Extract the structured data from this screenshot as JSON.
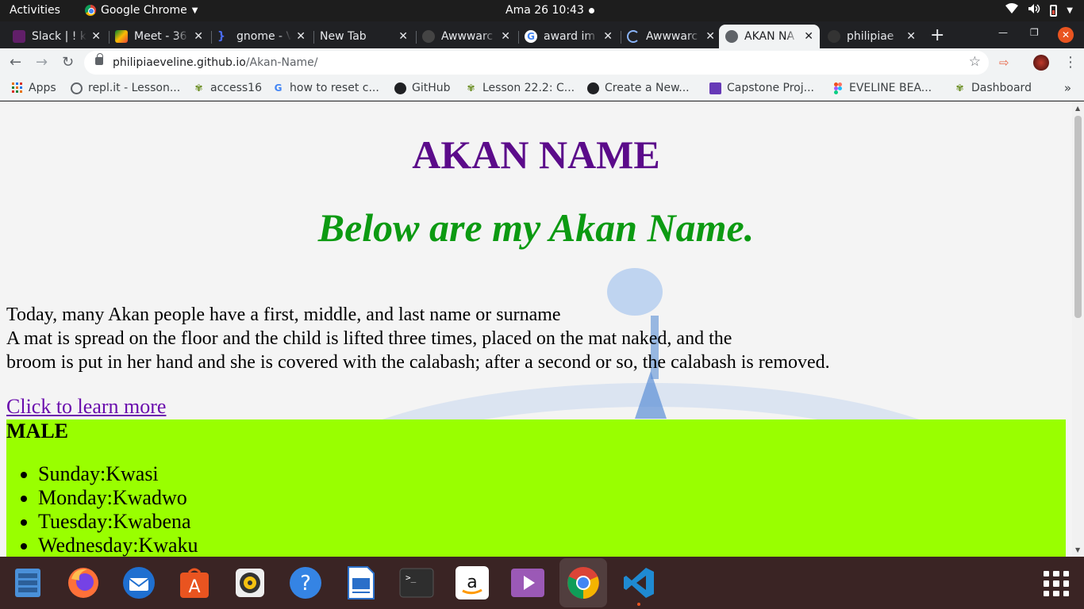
{
  "system_bar": {
    "activities": "Activities",
    "app_name": "Google Chrome",
    "clock": "Ama 26  10:43"
  },
  "tabs": [
    {
      "title": "Slack | ! ke",
      "favicon_color": "#611f69"
    },
    {
      "title": "Meet - 36",
      "favicon_color": "#00832d"
    },
    {
      "title": "gnome - V",
      "favicon_color": "#4a6cf7"
    },
    {
      "title": "New Tab",
      "favicon_color": ""
    },
    {
      "title": "Awwwarc",
      "favicon_color": "#444444"
    },
    {
      "title": "award im",
      "favicon_color": "#4285f4"
    },
    {
      "title": "Awwwarc",
      "favicon_color": "#8ab4f8"
    },
    {
      "title": "AKAN NA",
      "favicon_color": "#5f6368",
      "active": true
    },
    {
      "title": "philipiae",
      "favicon_color": "#333333"
    }
  ],
  "address_bar": {
    "domain": "philipiaeveline.github.io",
    "path": "/Akan-Name/"
  },
  "bookmarks": [
    {
      "label": "Apps",
      "icon": "apps-grid-icon"
    },
    {
      "label": "repl.it - Lesson...",
      "icon": "replit-icon"
    },
    {
      "label": "access16",
      "icon": "tree-icon"
    },
    {
      "label": "how to reset c...",
      "icon": "google-icon"
    },
    {
      "label": "GitHub",
      "icon": "github-icon"
    },
    {
      "label": "Lesson 22.2: C...",
      "icon": "tree-icon"
    },
    {
      "label": "Create a New...",
      "icon": "github-icon"
    },
    {
      "label": "Capstone Proj...",
      "icon": "form-icon"
    },
    {
      "label": "EVELINE BEA...",
      "icon": "figma-icon"
    },
    {
      "label": "Dashboard",
      "icon": "tree-icon"
    }
  ],
  "page": {
    "title": "AKAN NAME",
    "subtitle": "Below are my Akan Name.",
    "paragraph_lines": [
      "Today, many Akan people have a first, middle, and last name or surname",
      "A mat is spread on the floor and the child is lifted three times, placed on the mat naked, and the",
      "broom is put in her hand and she is covered with the calabash; after a second or so, the calabash is removed."
    ],
    "link_text": "Click to learn more",
    "male_heading": "MALE",
    "male_names": [
      "Sunday:Kwasi",
      "Monday:Kwadwo",
      "Tuesday:Kwabena",
      "Wednesday:Kwaku"
    ]
  },
  "colors": {
    "title": "#5b0b8a",
    "subtitle": "#0c9a12",
    "male_bg": "#99ff00",
    "link": "#6a0dad"
  },
  "dock": [
    {
      "icon": "files-icon"
    },
    {
      "icon": "firefox-icon"
    },
    {
      "icon": "thunderbird-icon"
    },
    {
      "icon": "software-center-icon"
    },
    {
      "icon": "rhythmbox-icon"
    },
    {
      "icon": "help-icon"
    },
    {
      "icon": "libreoffice-writer-icon"
    },
    {
      "icon": "terminal-icon"
    },
    {
      "icon": "amazon-icon"
    },
    {
      "icon": "videos-icon"
    },
    {
      "icon": "chrome-icon"
    },
    {
      "icon": "vscode-icon"
    }
  ]
}
